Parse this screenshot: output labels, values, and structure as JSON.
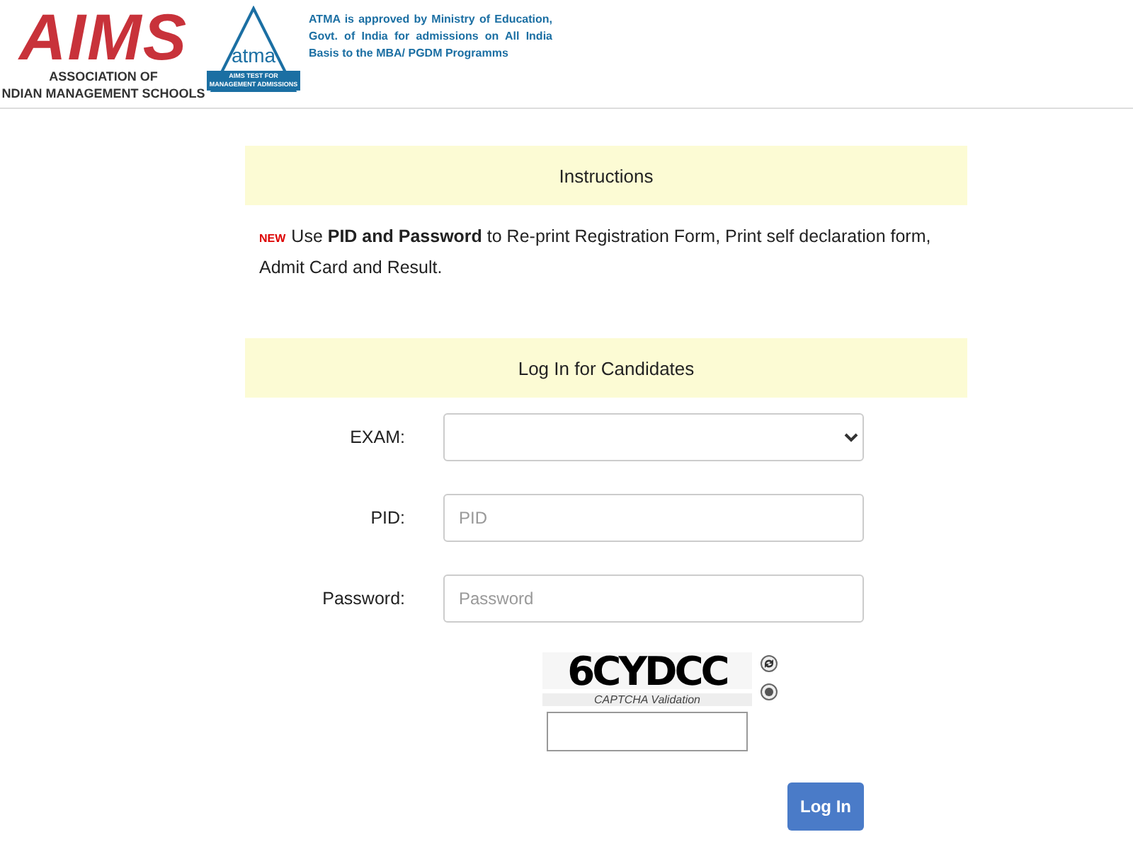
{
  "header": {
    "logo_title": "AIMS",
    "logo_subtitle": [
      "ASSOCIATION OF",
      "NDIAN MANAGEMENT SCHOOLS"
    ],
    "atma_logo": {
      "word": "atma",
      "caption": [
        "AIMS TEST FOR",
        "MANAGEMENT ADMISSIONS"
      ]
    },
    "approval_note": "ATMA is approved by Ministry of Education, Govt. of India for admissions on All India Basis to the MBA/ PGDM Programms"
  },
  "instructions": {
    "title": "Instructions",
    "badge": "NEW",
    "text": "Use **PID and Password** to Re-print Registration Form, Print self declaration form, Admit Card and Result."
  },
  "login": {
    "title": "Log In for Candidates",
    "fields": [
      {
        "kind": "select",
        "label": "EXAM:"
      },
      {
        "kind": "text",
        "label": "PID:",
        "placeholder": "PID"
      },
      {
        "kind": "password",
        "label": "Password:",
        "placeholder": "Password"
      }
    ],
    "captcha": {
      "code": "6CYDCC",
      "caption": "CAPTCHA Validation"
    },
    "button": "Log In"
  }
}
